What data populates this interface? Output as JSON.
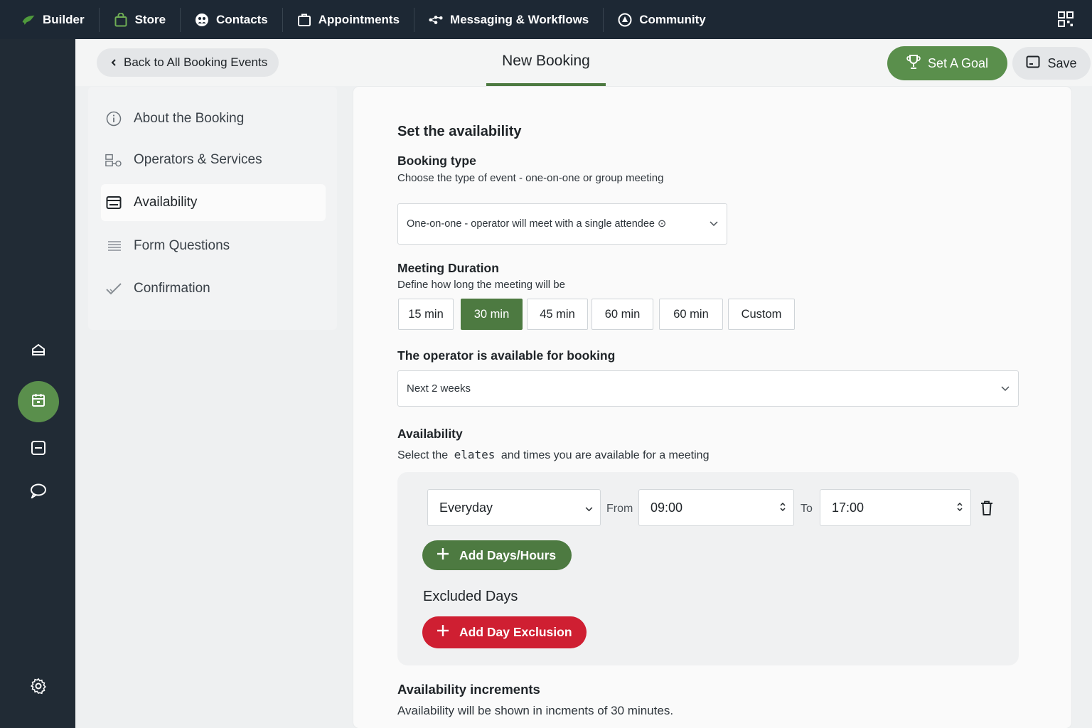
{
  "topnav": {
    "items": [
      {
        "label": "Builder",
        "icon": "leaf-logo-icon"
      },
      {
        "label": "Store",
        "icon": "shopping-bag-icon"
      },
      {
        "label": "Contacts",
        "icon": "contacts-icon"
      },
      {
        "label": "Appointments",
        "icon": "briefcase-icon"
      },
      {
        "label": "Messaging & Workflows",
        "icon": "workflow-icon"
      },
      {
        "label": "Community",
        "icon": "community-icon"
      }
    ],
    "right_icon": "apps-grid-icon"
  },
  "rail": {
    "icons": [
      "home-icon",
      "calendar-icon",
      "card-icon",
      "chat-icon",
      "settings-icon"
    ],
    "active": "calendar-icon"
  },
  "header": {
    "back_label": "Back to All Booking Events",
    "title": "New Booking",
    "goal_label": "Set A Goal",
    "save_label": "Save"
  },
  "sidemenu": {
    "items": [
      {
        "label": "About the Booking",
        "icon": "info-icon"
      },
      {
        "label": "Operators & Services",
        "icon": "services-icon"
      },
      {
        "label": "Availability",
        "icon": "availability-icon"
      },
      {
        "label": "Form Questions",
        "icon": "list-icon"
      },
      {
        "label": "Confirmation",
        "icon": "check-icon"
      }
    ],
    "active": "Availability"
  },
  "main": {
    "section_title": "Set the availability",
    "booking_type": {
      "label": "Booking type",
      "description": "Choose the type of event - one-on-one or group meeting",
      "value": "One-on-one - operator will meet with a single attendee ⊙"
    },
    "duration": {
      "label": "Meeting Duration",
      "description": "Define how long the meeting will be",
      "options": [
        "15 min",
        "30 min",
        "45 min",
        "60 min",
        "60 min",
        "Custom"
      ],
      "selected": "30 min"
    },
    "window": {
      "label": "The operator is available for booking",
      "value": "Next 2 weeks"
    },
    "availability": {
      "label": "Availability",
      "description_pre": "Select the",
      "description_word": "elates",
      "description_post": "and times you are available for a meeting",
      "day": "Everyday",
      "from_label": "From",
      "from_value": "09:00",
      "to_label": "To",
      "to_value": "17:00",
      "add_label": "Add Days/Hours",
      "excluded_label": "Excluded Days",
      "exclusion_label": "Add Day Exclusion"
    },
    "increments": {
      "label": "Availability increments",
      "description": "Availability will be shown in incments of 30 minutes."
    }
  },
  "colors": {
    "nav_bg": "#1d2834",
    "accent_green": "#4d7a41",
    "button_green": "#5a8f4c",
    "danger_red": "#cf1f32"
  }
}
